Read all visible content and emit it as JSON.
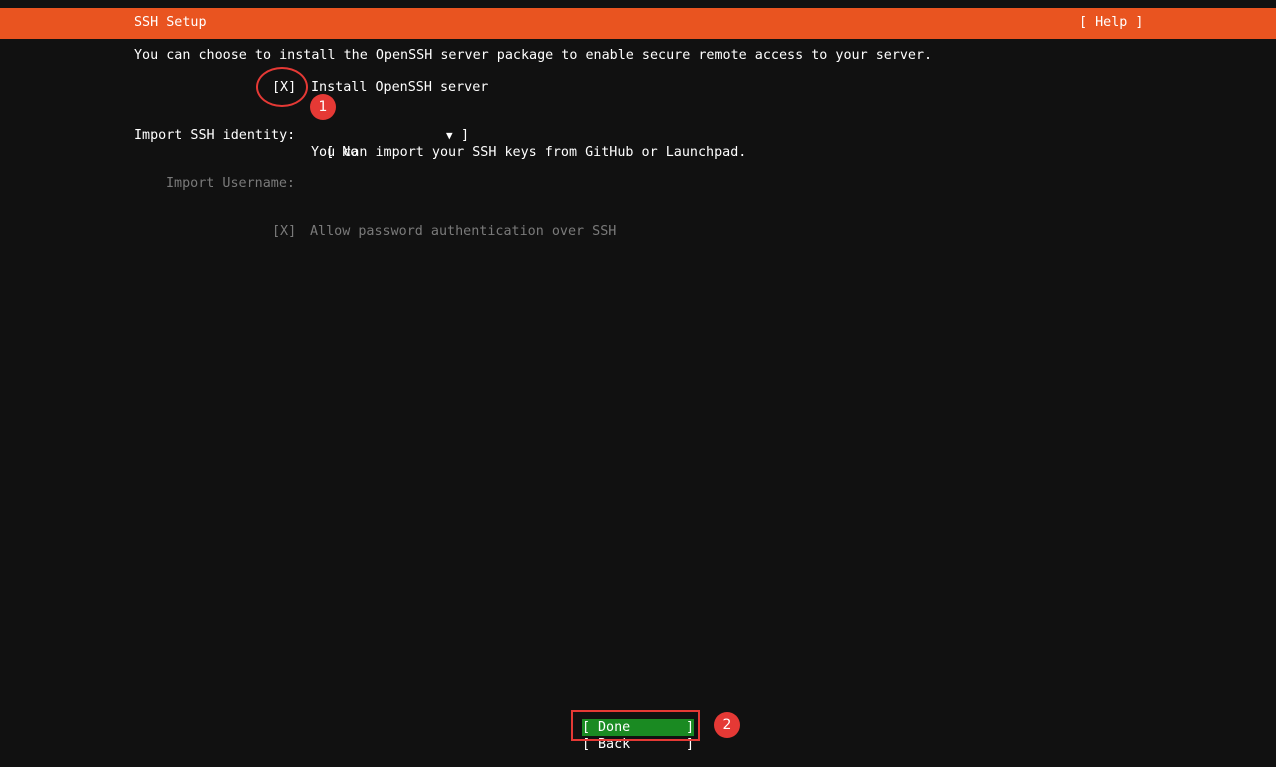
{
  "header": {
    "title": "SSH Setup",
    "help_label": "[ Help ]"
  },
  "intro_text": "You can choose to install the OpenSSH server package to enable secure remote access to your server.",
  "install_openssh": {
    "checkbox": "[X]",
    "label": "Install OpenSSH server"
  },
  "import_identity": {
    "label": "Import SSH identity:",
    "open_bracket": "[ ",
    "value": "No",
    "caret": "▼",
    "close_bracket": "]",
    "help_text": "You can import your SSH keys from GitHub or Launchpad."
  },
  "import_username": {
    "label": "Import Username:"
  },
  "allow_password": {
    "checkbox": "[X]",
    "label": "Allow password authentication over SSH"
  },
  "buttons": {
    "done": {
      "left": "[",
      "label": "Done",
      "right": "]"
    },
    "back": {
      "left": "[",
      "label": "Back",
      "right": "]"
    }
  },
  "annotations": {
    "badge_1": "1",
    "badge_2": "2"
  },
  "colors": {
    "header": "#e95420",
    "background": "#111111",
    "done_button": "#1a8a22",
    "annotation": "#e53935",
    "disabled_text": "#7a7a7a"
  }
}
